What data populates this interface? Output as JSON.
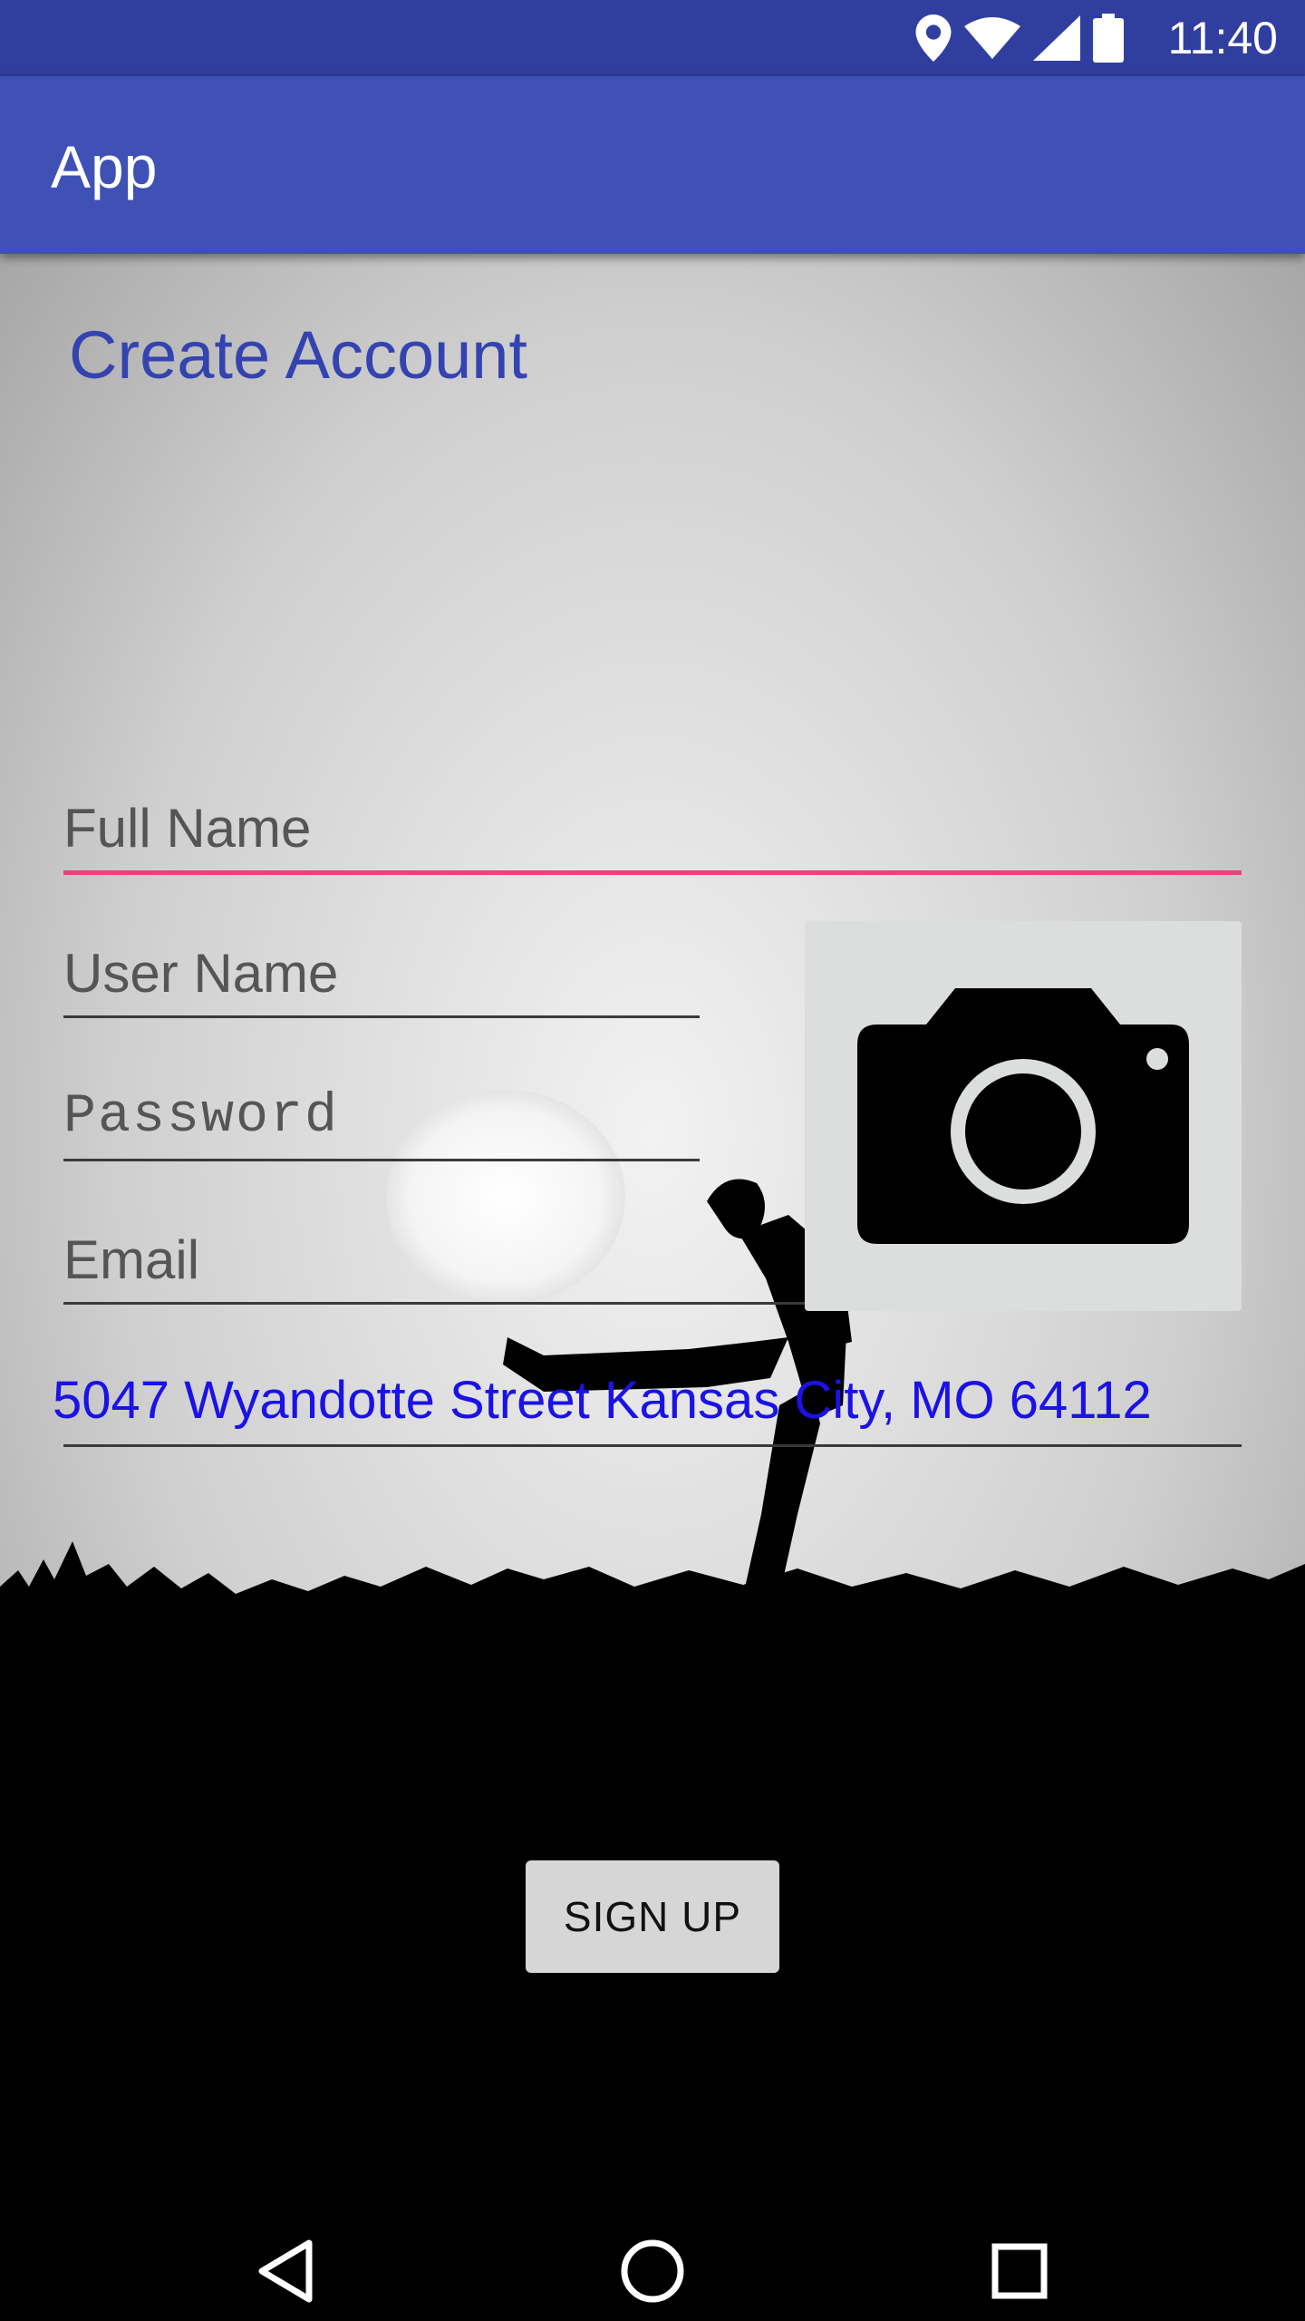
{
  "status_bar": {
    "time": "11:40",
    "icons": [
      "location-icon",
      "wifi-icon",
      "signal-icon",
      "battery-icon"
    ]
  },
  "app_bar": {
    "title": "App"
  },
  "form": {
    "heading": "Create Account",
    "full_name_placeholder": "Full Name",
    "user_name_placeholder": "User Name",
    "password_placeholder": "Password",
    "email_placeholder": "Email",
    "address_value": "5047 Wyandotte Street Kansas City, MO 64112",
    "photo_icon": "camera-icon",
    "signup_label": "SIGN UP"
  },
  "nav_bar": {
    "icons": [
      "back-icon",
      "home-icon",
      "recents-icon"
    ]
  },
  "colors": {
    "status_bar": "#303f9f",
    "app_bar": "#3f51b5",
    "accent": "#ee3f7e",
    "heading": "#3343b0",
    "address": "#1a12e6"
  }
}
